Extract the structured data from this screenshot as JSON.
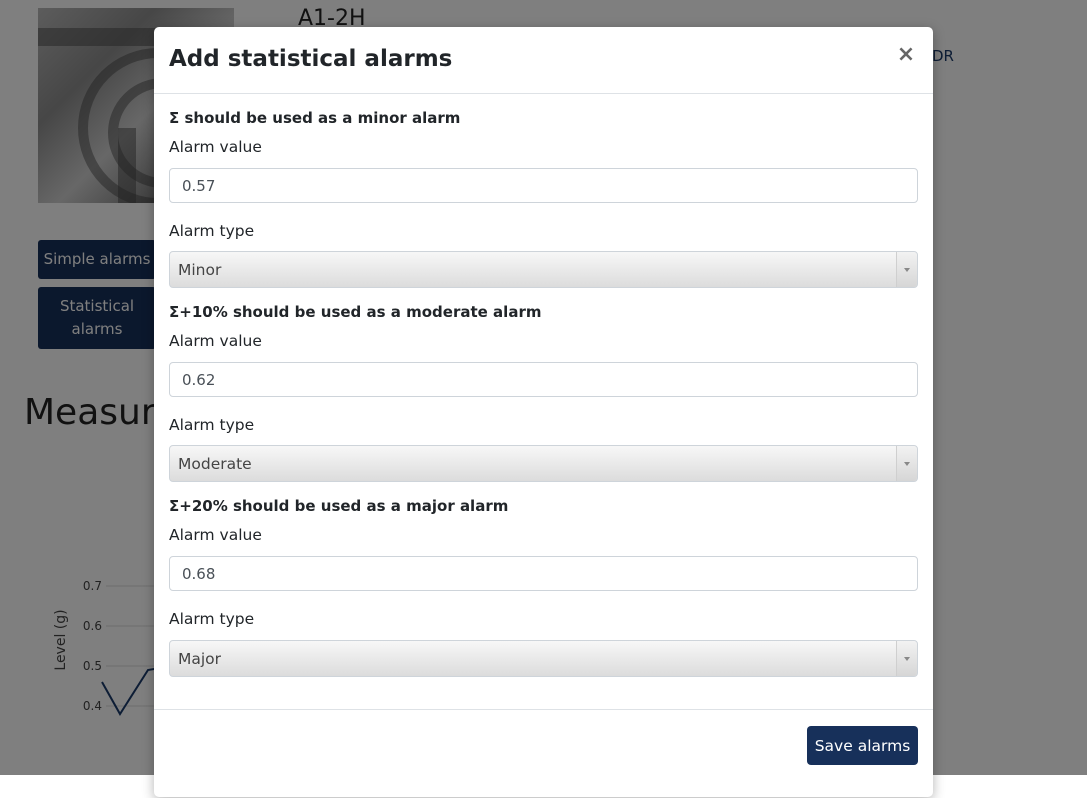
{
  "background": {
    "asset_title": "A1-2H",
    "top_right_link": "DR",
    "simple_alarms_label": "Simple alarms",
    "statistical_alarms_label": "Statistical alarms",
    "section_heading": "Measure",
    "chart": {
      "ylabel": "Level (g)",
      "ticks": [
        "0.7",
        "0.6",
        "0.5",
        "0.4"
      ]
    }
  },
  "modal": {
    "title": "Add statistical alarms",
    "close_symbol": "×",
    "groups": [
      {
        "title": "Σ should be used as a minor alarm",
        "value_label": "Alarm value",
        "value": "0.57",
        "type_label": "Alarm type",
        "type": "Minor"
      },
      {
        "title": "Σ+10% should be used as a moderate alarm",
        "value_label": "Alarm value",
        "value": "0.62",
        "type_label": "Alarm type",
        "type": "Moderate"
      },
      {
        "title": "Σ+20% should be used as a major alarm",
        "value_label": "Alarm value",
        "value": "0.68",
        "type_label": "Alarm type",
        "type": "Major"
      }
    ],
    "save_label": "Save alarms"
  },
  "colors": {
    "primary": "#17305a",
    "overlay": "rgba(0,0,0,0.5)"
  }
}
